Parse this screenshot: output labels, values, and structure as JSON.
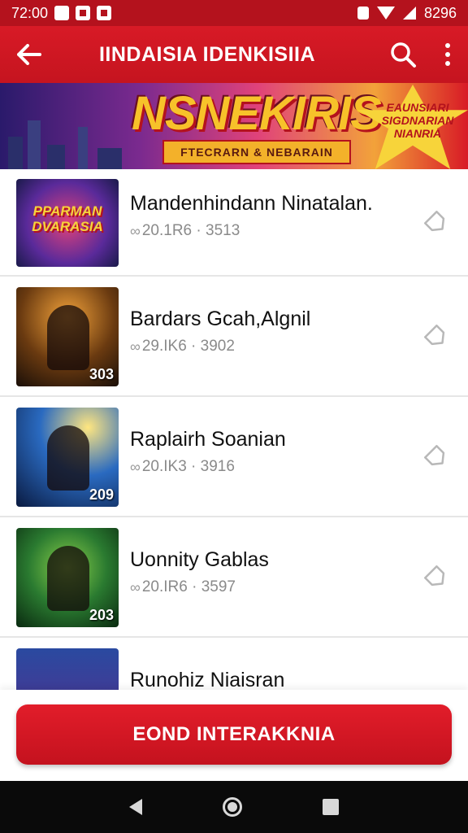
{
  "status_bar": {
    "time": "72:00",
    "battery": "8296"
  },
  "app_bar": {
    "title": "IINDAISIA IDENKISIIA"
  },
  "banner": {
    "headline": "NSNEKIRIS",
    "subtitle": "FTECRARN & NEBARAIN",
    "badge_lines": [
      "EAUNSIARI",
      "SIGDNARIAN",
      "NIANRIA"
    ]
  },
  "list": {
    "items": [
      {
        "title": "Mandenhindann Ninatalan.",
        "meta": "20.1R6 · 3513",
        "thumb_label": "PPARMAN DVARASIA",
        "count": ""
      },
      {
        "title": "Bardars Gcah,Algnil",
        "meta": "29.IK6 · 3902",
        "thumb_label": "",
        "count": "303"
      },
      {
        "title": "Raplairh Soanian",
        "meta": "20.IK3 · 3916",
        "thumb_label": "",
        "count": "209"
      },
      {
        "title": "Uonnity Gablas",
        "meta": "20.IR6 · 3597",
        "thumb_label": "",
        "count": "203"
      },
      {
        "title": "Runohiz Niaisran",
        "meta": "",
        "thumb_label": "",
        "count": ""
      }
    ]
  },
  "cta": {
    "label": "EOND INTERAKKNIA"
  },
  "colors": {
    "primary": "#d81a26",
    "status_bar": "#b4121d",
    "nav_bar": "#0a0a0a"
  },
  "icons": {
    "back": "arrow-left-icon",
    "search": "search-icon",
    "more": "more-vert-icon",
    "item_action": "tag-icon",
    "meta": "link-icon"
  }
}
